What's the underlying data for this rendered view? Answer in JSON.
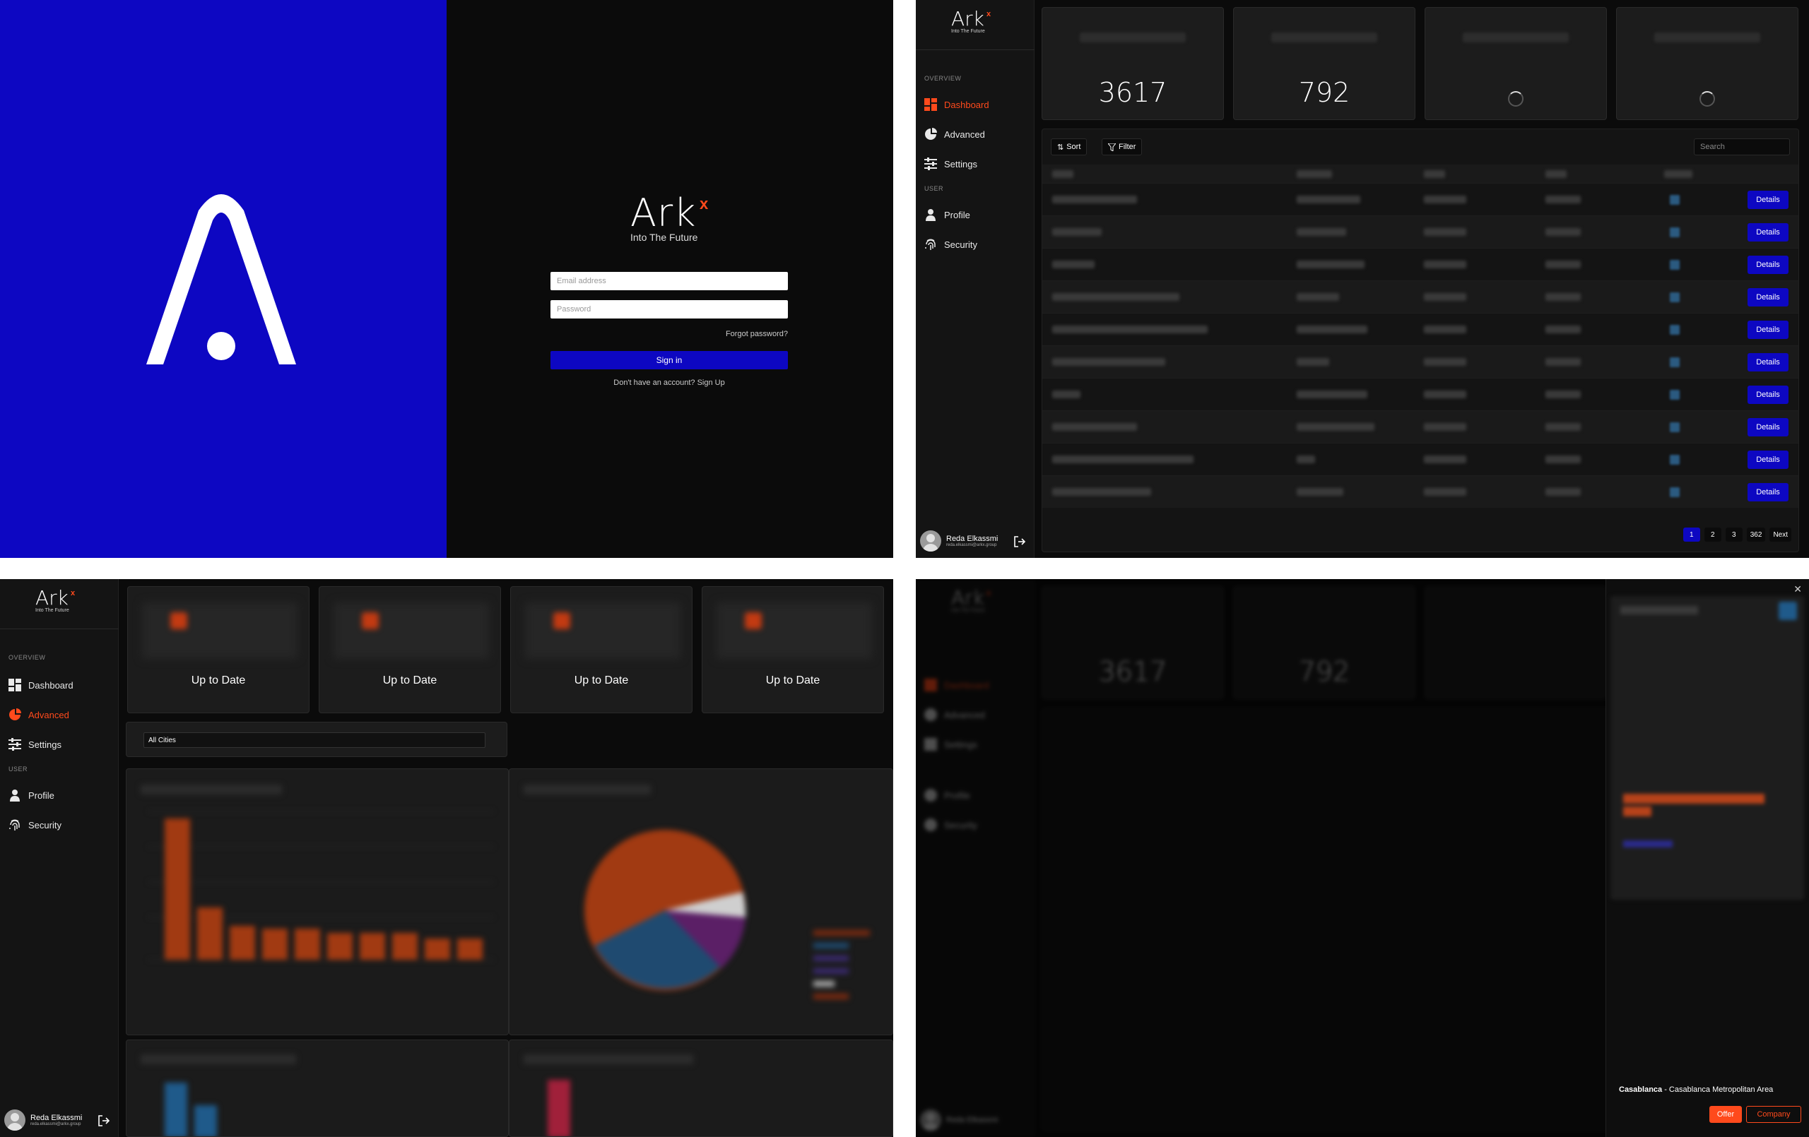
{
  "brand": {
    "name": "Ark",
    "mark": "x",
    "tagline": "Into The Future"
  },
  "colors": {
    "brand_blue": "#0d07c2",
    "accent_orange": "#ff4a1c",
    "background": "#0b0b0b"
  },
  "login": {
    "email_placeholder": "Email address",
    "password_placeholder": "Password",
    "forgot_label": "Forgot password?",
    "signin_label": "Sign in",
    "signup_label": "Don't have an account? Sign Up"
  },
  "sidebar": {
    "overview_label": "OVERVIEW",
    "user_label": "USER",
    "items": [
      {
        "label": "Dashboard",
        "icon": "dashboard-icon"
      },
      {
        "label": "Advanced",
        "icon": "pie-chart-icon"
      },
      {
        "label": "Settings",
        "icon": "sliders-icon"
      },
      {
        "label": "Profile",
        "icon": "person-icon"
      },
      {
        "label": "Security",
        "icon": "fingerprint-icon"
      }
    ],
    "user": {
      "name": "Reda Elkassmi",
      "email": "reda.elkassmi@arkx.group"
    }
  },
  "dashboard": {
    "stats": [
      {
        "value": "3617",
        "loading": false
      },
      {
        "value": "792",
        "loading": false
      },
      {
        "value": "",
        "loading": true
      },
      {
        "value": "",
        "loading": true
      }
    ],
    "toolbar": {
      "sort_label": "Sort",
      "filter_label": "Filter",
      "search_placeholder": "Search"
    },
    "row_action_label": "Details",
    "row_count": 10,
    "pagination": [
      "1",
      "2",
      "3",
      "362",
      "Next"
    ]
  },
  "advanced": {
    "status_cards": [
      "Up to Date",
      "Up to Date",
      "Up to Date",
      "Up to Date"
    ],
    "city_filter": "All Cities"
  },
  "drawer": {
    "close_icon": "close-icon",
    "city": "Casablanca",
    "region": " - Casablanca Metropolitan Area",
    "offer_label": "Offer",
    "company_label": "Company"
  }
}
